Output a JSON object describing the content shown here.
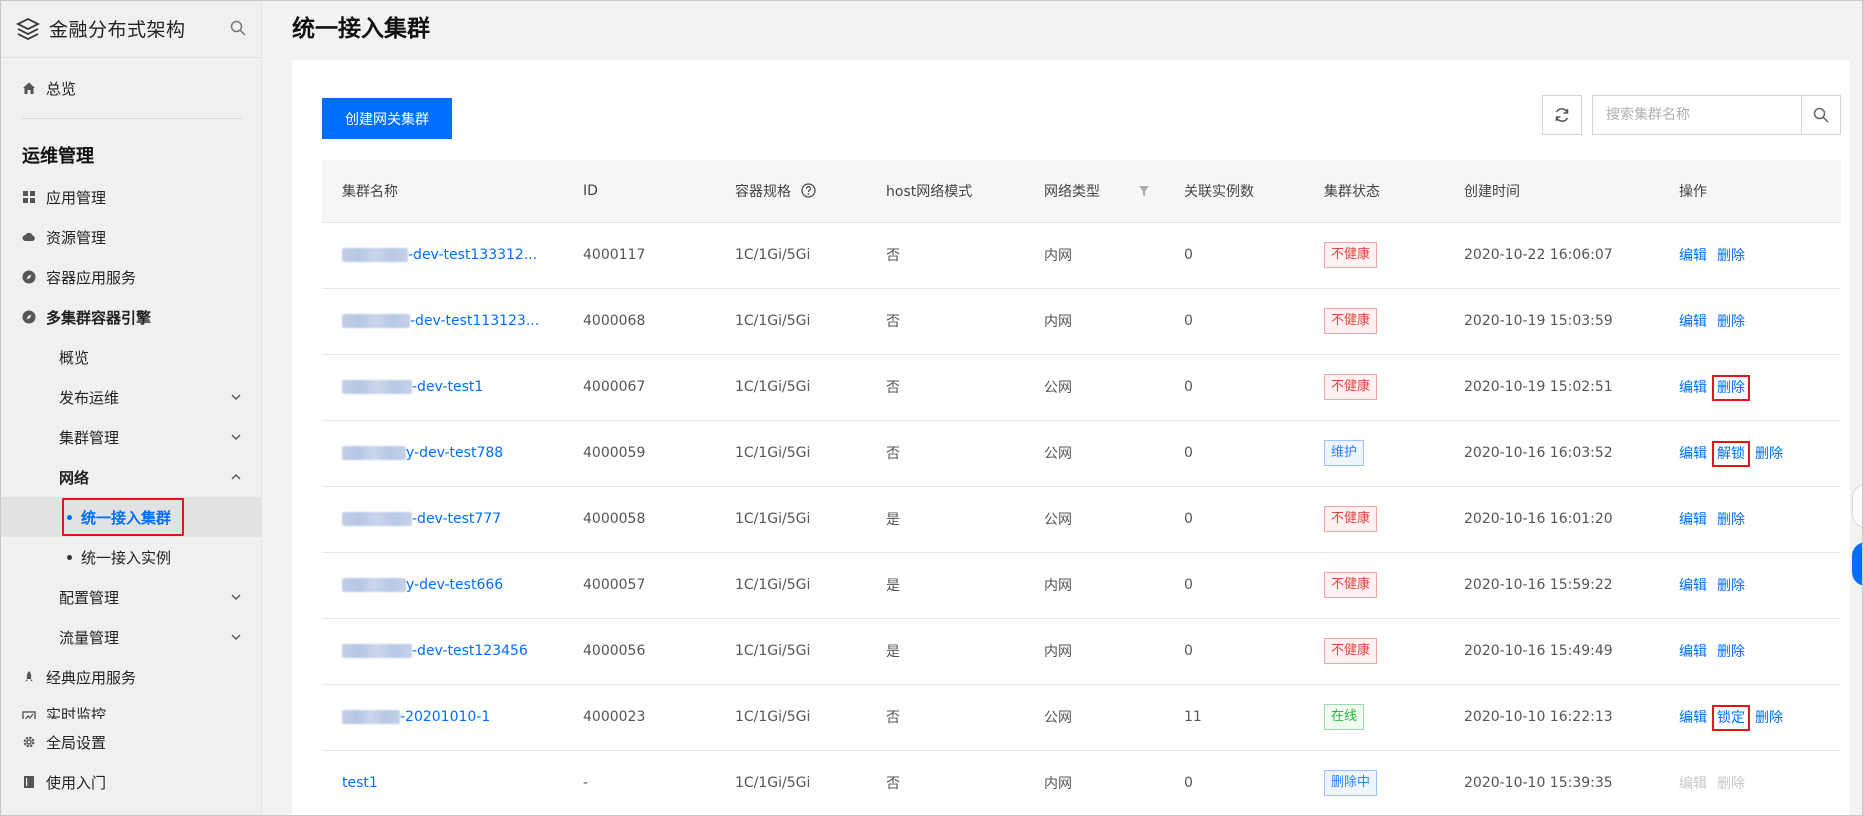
{
  "sidebar": {
    "brand": "金融分布式架构",
    "overview": "总览",
    "section": "运维管理",
    "items": [
      {
        "label": "应用管理",
        "icon": "grid-icon"
      },
      {
        "label": "资源管理",
        "icon": "cloud-icon"
      },
      {
        "label": "容器应用服务",
        "icon": "compass-icon"
      },
      {
        "label": "多集群容器引擎",
        "icon": "compass-icon"
      }
    ],
    "sub": {
      "overview": "概览",
      "publish": "发布运维",
      "cluster_mgmt": "集群管理",
      "network": "网络",
      "unified_cluster": "统一接入集群",
      "unified_instance": "统一接入实例",
      "config": "配置管理",
      "traffic": "流量管理"
    },
    "classic": "经典应用服务",
    "monitor": "实时监控",
    "global": "全局设置",
    "guide": "使用入门"
  },
  "page": {
    "title": "统一接入集群",
    "create_button": "创建网关集群",
    "search_placeholder": "搜索集群名称"
  },
  "table": {
    "headers": [
      "集群名称",
      "ID",
      "容器规格",
      "host网络模式",
      "网络类型",
      "关联实例数",
      "集群状态",
      "创建时间",
      "操作"
    ],
    "rows": [
      {
        "name": "-dev-test133312...",
        "id": "4000117",
        "spec": "1C/1Gi/5Gi",
        "host": "否",
        "net": "内网",
        "count": "0",
        "status": "不健康",
        "time": "2020-10-22 16:06:07",
        "ops": [
          "编辑",
          "删除"
        ]
      },
      {
        "name": "-dev-test113123...",
        "id": "4000068",
        "spec": "1C/1Gi/5Gi",
        "host": "否",
        "net": "内网",
        "count": "0",
        "status": "不健康",
        "time": "2020-10-19 15:03:59",
        "ops": [
          "编辑",
          "删除"
        ]
      },
      {
        "name": "-dev-test1",
        "id": "4000067",
        "spec": "1C/1Gi/5Gi",
        "host": "否",
        "net": "公网",
        "count": "0",
        "status": "不健康",
        "time": "2020-10-19 15:02:51",
        "ops": [
          "编辑",
          "删除"
        ]
      },
      {
        "name": "y-dev-test788",
        "id": "4000059",
        "spec": "1C/1Gi/5Gi",
        "host": "否",
        "net": "公网",
        "count": "0",
        "status": "维护",
        "time": "2020-10-16 16:03:52",
        "ops": [
          "编辑",
          "解锁",
          "删除"
        ]
      },
      {
        "name": "-dev-test777",
        "id": "4000058",
        "spec": "1C/1Gi/5Gi",
        "host": "是",
        "net": "公网",
        "count": "0",
        "status": "不健康",
        "time": "2020-10-16 16:01:20",
        "ops": [
          "编辑",
          "删除"
        ]
      },
      {
        "name": "y-dev-test666",
        "id": "4000057",
        "spec": "1C/1Gi/5Gi",
        "host": "是",
        "net": "内网",
        "count": "0",
        "status": "不健康",
        "time": "2020-10-16 15:59:22",
        "ops": [
          "编辑",
          "删除"
        ]
      },
      {
        "name": "-dev-test123456",
        "id": "4000056",
        "spec": "1C/1Gi/5Gi",
        "host": "是",
        "net": "内网",
        "count": "0",
        "status": "不健康",
        "time": "2020-10-16 15:49:49",
        "ops": [
          "编辑",
          "删除"
        ]
      },
      {
        "name": "-20201010-1",
        "id": "4000023",
        "spec": "1C/1Gi/5Gi",
        "host": "否",
        "net": "公网",
        "count": "11",
        "status": "在线",
        "time": "2020-10-10 16:22:13",
        "ops": [
          "编辑",
          "锁定",
          "删除"
        ]
      },
      {
        "name": "test1",
        "id": "-",
        "spec": "1C/1Gi/5Gi",
        "host": "否",
        "net": "内网",
        "count": "0",
        "status": "删除中",
        "time": "2020-10-10 15:39:35",
        "ops": [
          "编辑",
          "删除"
        ]
      }
    ]
  },
  "colors": {
    "primary": "#006eff",
    "danger": "#e54545",
    "success": "#29b43b",
    "highlight_box": "#e2151b"
  }
}
